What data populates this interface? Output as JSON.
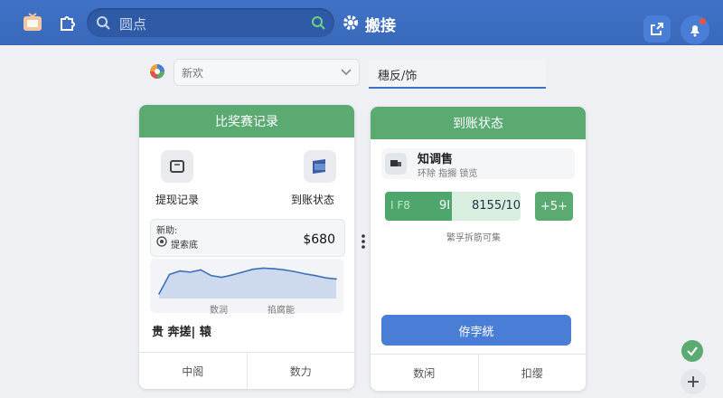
{
  "topbar": {
    "search_placeholder": "圆点",
    "title": "搬接"
  },
  "filters": {
    "select_value": "新欢",
    "tab_value": "穗反/饰"
  },
  "left_card": {
    "header": "比奖赛记录",
    "action1_label": "提现记录",
    "action2_label": "到账状态",
    "balance_title": "新助:",
    "balance_sub": "提索底",
    "balance_value": "$680",
    "legend1": "数润",
    "legend2": "掐腐能",
    "summary_text": "贵 奔搓| 辕",
    "footer_left": "中阁",
    "footer_right": "数力",
    "chart_data": {
      "type": "line",
      "series": [
        {
          "values": [
            8,
            42,
            48,
            46,
            50,
            40,
            37,
            41,
            46,
            51,
            53,
            52,
            50,
            47,
            43,
            40,
            36,
            34
          ]
        }
      ]
    }
  },
  "right_card": {
    "header": "到账状态",
    "item_title": "知调售",
    "item_sub": "环除 指搁 锁览",
    "stat_left": "I F8",
    "stat_mid": "9I",
    "stat_value": "8155/10",
    "plus_label": "+5+",
    "hint": "繁孚拆筋可集",
    "primary_button": "侟孛絖",
    "footer_left": "数闲",
    "footer_right": "扣缨"
  },
  "colors": {
    "topbar": "#3f72c6",
    "card_header": "#5aaa72",
    "primary": "#4a7ed6",
    "stat_green": "#5aaa72"
  }
}
